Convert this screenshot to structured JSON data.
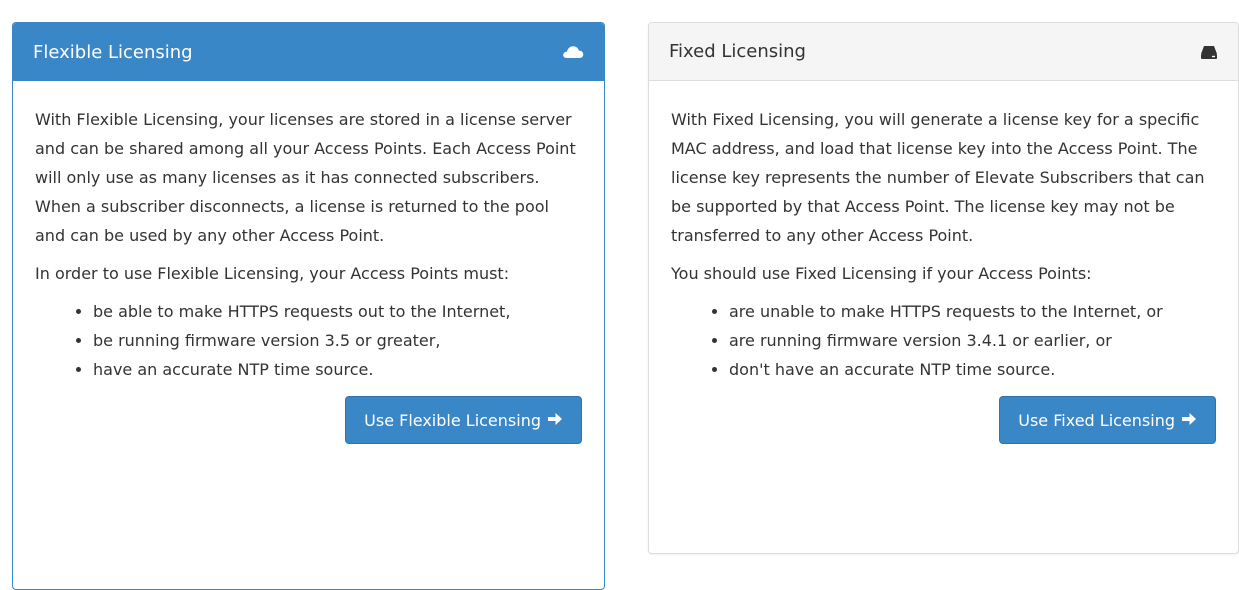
{
  "flexible": {
    "title": "Flexible Licensing",
    "heading_icon": "cloud-icon",
    "paragraph1": "With Flexible Licensing, your licenses are stored in a license server and can be shared among all your Access Points. Each Access Point will only use as many licenses as it has connected subscribers. When a subscriber disconnects, a license is returned to the pool and can be used by any other Access Point.",
    "paragraph2": "In order to use Flexible Licensing, your Access Points must:",
    "requirements": [
      "be able to make HTTPS requests out to the Internet,",
      "be running firmware version 3.5 or greater,",
      "have an accurate NTP time source."
    ],
    "button_label": "Use Flexible Licensing",
    "button_icon": "arrow-right-icon"
  },
  "fixed": {
    "title": "Fixed Licensing",
    "heading_icon": "hdd-icon",
    "paragraph1": "With Fixed Licensing, you will generate a license key for a specific MAC address, and load that license key into the Access Point. The license key represents the number of Elevate Subscribers that can be supported by that Access Point. The license key may not be transferred to any other Access Point.",
    "paragraph2": "You should use Fixed Licensing if your Access Points:",
    "conditions": [
      "are unable to make HTTPS requests to the Internet, or",
      "are running firmware version 3.4.1 or earlier, or",
      "don't have an accurate NTP time source."
    ],
    "button_label": "Use Fixed Licensing",
    "button_icon": "arrow-right-icon"
  },
  "colors": {
    "primary": "#3a87c8",
    "panel_heading_default": "#f5f5f5",
    "text": "#333333"
  }
}
